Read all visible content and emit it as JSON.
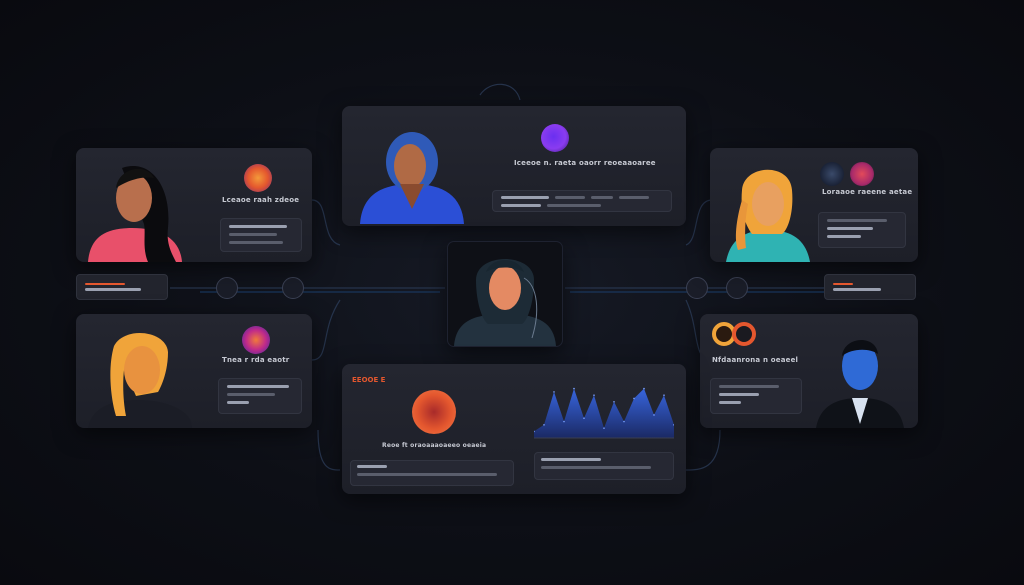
{
  "colors": {
    "background": "#0d0f16",
    "card": "#22242d",
    "accent_blue": "#2b4fd6",
    "accent_orange": "#e4572e",
    "accent_purple": "#8a3cf0",
    "accent_pink": "#e8506a",
    "accent_teal": "#2fb3b3"
  },
  "cards": {
    "top_center": {
      "title": "Iceeoe n. raeta oaorr reoeaaoaree"
    },
    "left_top": {
      "title": "Lceaoe raah zdeoe"
    },
    "left_bottom": {
      "title": "Tnea r rda eaotr"
    },
    "right_top": {
      "title": "Loraaoe raeene aetae"
    },
    "right_bottom": {
      "title": "Nfdaanrona n oeaeel"
    },
    "bottom_center": {
      "header": "EEOOE E",
      "caption": "Reoe ft oraoaaaoaeeo oeaeia"
    }
  },
  "icons": {
    "avatars": [
      "woman-dark-hair-avatar",
      "man-blue-avatar",
      "woman-blonde-avatar",
      "woman-yellow-hair-avatar",
      "man-suit-avatar",
      "woman-hood-avatar"
    ],
    "badges": [
      "orange-badge-icon",
      "purple-badge-icon",
      "pink-badge-icon",
      "red-badge-icon",
      "ring-badge-icon",
      "dark-badge-icon"
    ]
  },
  "chart_data": {
    "type": "area",
    "series": [
      {
        "values": [
          4,
          8,
          28,
          10,
          30,
          12,
          26,
          6,
          22,
          10,
          24,
          30,
          14,
          26,
          8
        ]
      }
    ],
    "ylim": [
      0,
      34
    ]
  }
}
